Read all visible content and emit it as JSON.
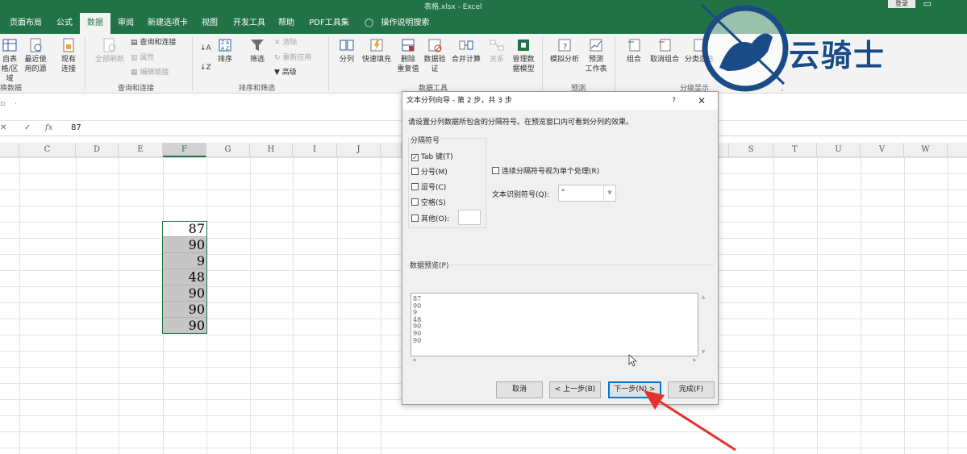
{
  "titlebar": {
    "doc": "表格.xlsx  -  Excel",
    "login": "登录"
  },
  "tabs": [
    {
      "label": "页面布局",
      "active": false
    },
    {
      "label": "公式",
      "active": false
    },
    {
      "label": "数据",
      "active": true
    },
    {
      "label": "审阅",
      "active": false
    },
    {
      "label": "新建选项卡",
      "active": false
    },
    {
      "label": "视图",
      "active": false
    },
    {
      "label": "开发工具",
      "active": false
    },
    {
      "label": "帮助",
      "active": false
    },
    {
      "label": "PDF工具集",
      "active": false
    }
  ],
  "tell_me": "操作说明搜索",
  "ribbon": {
    "get_data_a": "自表",
    "get_data_b": "格/区域",
    "recent_a": "最近使",
    "recent_b": "用的源",
    "existing_a": "现有",
    "existing_b": "连接",
    "group_transform": "换数据",
    "refresh_all": "全部刷新",
    "queries_conn": "查询和连接",
    "properties": "属性",
    "edit_links": "编辑链接",
    "group_queries": "查询和连接",
    "sort": "排序",
    "filter": "筛选",
    "clear": "清除",
    "reapply": "重新应用",
    "advanced": "高级",
    "group_sort": "排序和筛选",
    "text_to_columns": "分列",
    "flash_fill": "快速填充",
    "remove_dup_a": "删除",
    "remove_dup_b": "重复值",
    "validation_a": "数据验",
    "validation_b": "证",
    "consolidate": "合并计算",
    "relationships": "关系",
    "data_model_a": "管理数",
    "data_model_b": "据模型",
    "group_tools": "数据工具",
    "whatif": "模拟分析",
    "forecast_a": "预测",
    "forecast_b": "工作表",
    "group_forecast": "预测",
    "group": "组合",
    "ungroup": "取消组合",
    "subtotal": "分类汇总",
    "group_outline": "分级显示"
  },
  "formula_bar": {
    "fx": "fx",
    "value": "87"
  },
  "columns": [
    "C",
    "D",
    "E",
    "F",
    "G",
    "H",
    "I",
    "J",
    "S",
    "T",
    "U",
    "V",
    "W"
  ],
  "cells": [
    "87",
    "90",
    "9",
    "48",
    "90",
    "90",
    "90"
  ],
  "dialog": {
    "title": "文本分列向导 - 第 2 步，共 3 步",
    "help": "?",
    "close": "✕",
    "description": "请设置分列数据所包含的分隔符号。在预览窗口内可看到分列的效果。",
    "delimiters_legend": "分隔符号",
    "tab_label": "Tab 键(T)",
    "semicolon_label": "分号(M)",
    "comma_label": "逗号(C)",
    "space_label": "空格(S)",
    "other_label": "其他(O):",
    "consecutive_label": "连续分隔符号视为单个处理(R)",
    "qualifier_label": "文本识别符号(Q):",
    "qualifier_value": "\"",
    "preview_legend": "数据预览(P)",
    "preview_lines": [
      "87",
      "90",
      "9",
      "48",
      "90",
      "90",
      "90"
    ],
    "cancel": "取消",
    "back": "< 上一步(B)",
    "next": "下一步(N) >",
    "finish": "完成(F)"
  },
  "watermark": {
    "text": "云骑士"
  },
  "colors": {
    "brand": "#217346",
    "accent": "#0078d7",
    "arrow": "#e8302c"
  }
}
